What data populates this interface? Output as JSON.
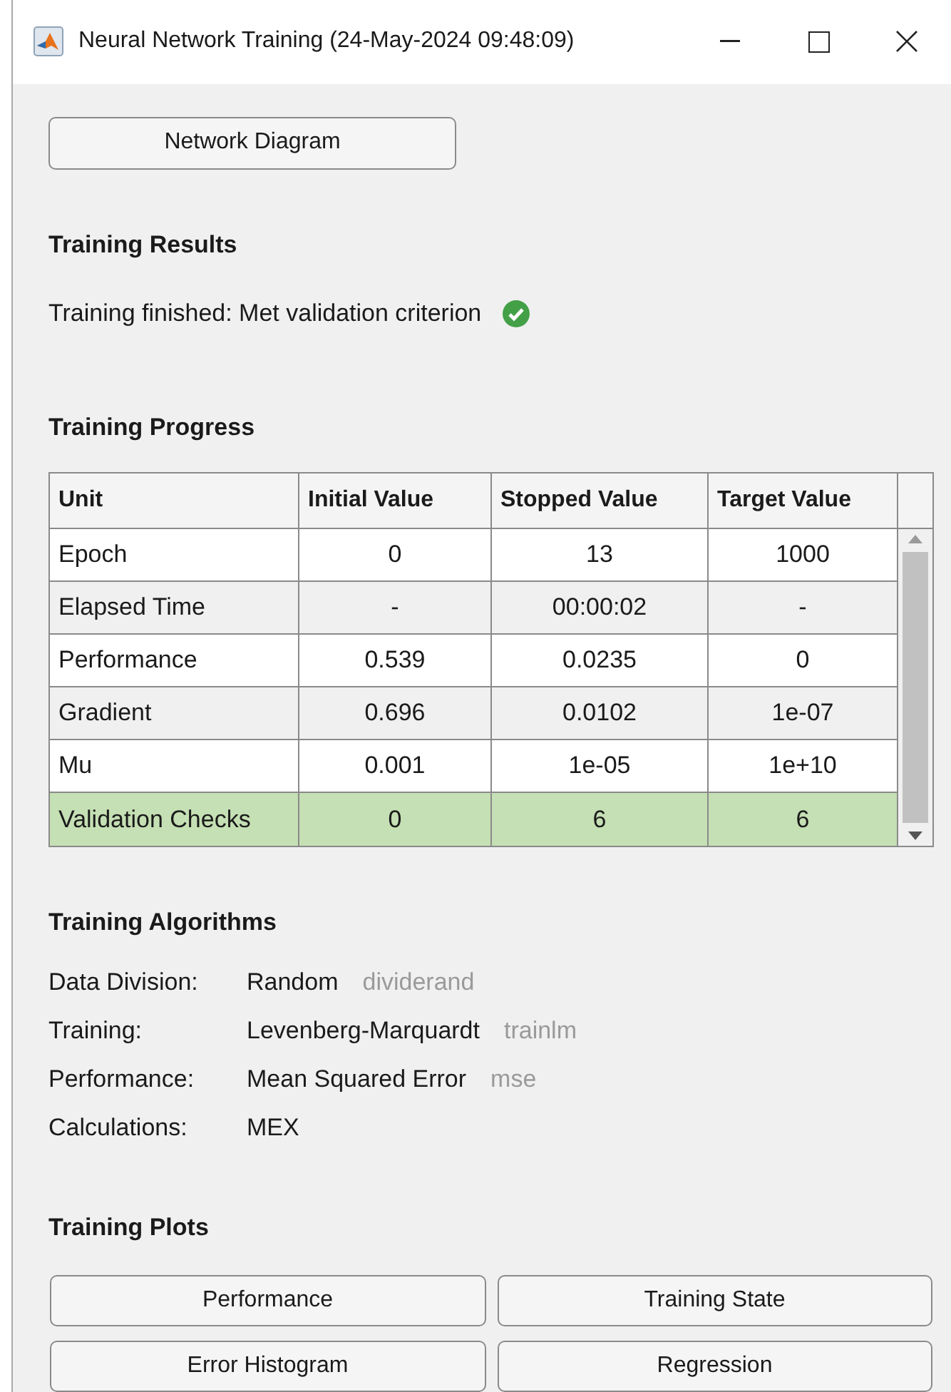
{
  "window": {
    "title": "Neural Network Training (24-May-2024 09:48:09)"
  },
  "network_button": "Network Diagram",
  "results": {
    "heading": "Training Results",
    "status": "Training finished: Met validation criterion",
    "success": true
  },
  "progress": {
    "heading": "Training Progress",
    "columns": [
      "Unit",
      "Initial Value",
      "Stopped Value",
      "Target Value"
    ],
    "rows": [
      {
        "cells": [
          "Epoch",
          "0",
          "13",
          "1000"
        ],
        "highlighted": false
      },
      {
        "cells": [
          "Elapsed Time",
          "-",
          "00:00:02",
          "-"
        ],
        "highlighted": false
      },
      {
        "cells": [
          "Performance",
          "0.539",
          "0.0235",
          "0"
        ],
        "highlighted": false
      },
      {
        "cells": [
          "Gradient",
          "0.696",
          "0.0102",
          "1e-07"
        ],
        "highlighted": false
      },
      {
        "cells": [
          "Mu",
          "0.001",
          "1e-05",
          "1e+10"
        ],
        "highlighted": false
      },
      {
        "cells": [
          "Validation Checks",
          "0",
          "6",
          "6"
        ],
        "highlighted": true
      }
    ]
  },
  "algorithms": {
    "heading": "Training Algorithms",
    "items": [
      {
        "label": "Data Division:",
        "value": "Random",
        "function": "dividerand"
      },
      {
        "label": "Training:",
        "value": "Levenberg-Marquardt",
        "function": "trainlm"
      },
      {
        "label": "Performance:",
        "value": "Mean Squared Error",
        "function": "mse"
      },
      {
        "label": "Calculations:",
        "value": "MEX"
      }
    ]
  },
  "plots": {
    "heading": "Training Plots",
    "buttons": [
      "Performance",
      "Training State",
      "Error Histogram",
      "Regression"
    ]
  }
}
